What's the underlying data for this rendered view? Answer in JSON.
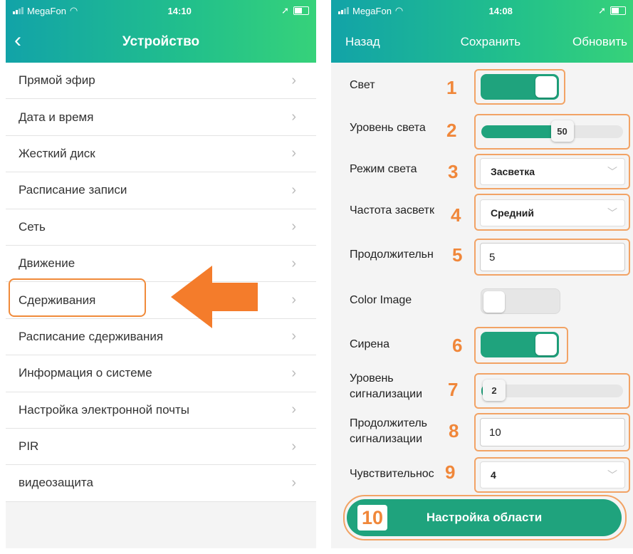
{
  "left": {
    "status": {
      "carrier": "MegaFon",
      "time": "14:10"
    },
    "header": {
      "back": "‹",
      "title": "Устройство"
    },
    "menu": [
      {
        "label": "Прямой эфир"
      },
      {
        "label": "Дата и время"
      },
      {
        "label": "Жесткий диск"
      },
      {
        "label": "Расписание записи"
      },
      {
        "label": "Сеть"
      },
      {
        "label": "Движение"
      },
      {
        "label": "Сдерживания"
      },
      {
        "label": "Расписание сдерживания"
      },
      {
        "label": "Информация о системе"
      },
      {
        "label": "Настройка электронной почты"
      },
      {
        "label": "PIR"
      },
      {
        "label": "видеозащита"
      }
    ],
    "chevron": "›",
    "highlighted_item": "Сдерживания",
    "arrow_color": "#f47c2b"
  },
  "right": {
    "status": {
      "carrier": "MegaFon",
      "time": "14:08"
    },
    "header": {
      "back": "Назад",
      "save": "Сохранить",
      "refresh": "Обновить"
    },
    "light": {
      "label": "Свет",
      "state": true,
      "marker": "1"
    },
    "light_level": {
      "label": "Уровень света",
      "value": "50",
      "fraction": 0.5,
      "marker": "2"
    },
    "light_mode": {
      "label": "Режим света",
      "value": "Засветка",
      "marker": "3"
    },
    "flash_freq": {
      "label": "Частота засветк",
      "value": "Средний",
      "marker": "4"
    },
    "duration": {
      "label": "Продолжительн",
      "value": "5",
      "marker": "5"
    },
    "color_image": {
      "label": "Color Image",
      "state": false
    },
    "siren": {
      "label": "Сирена",
      "state": true,
      "marker": "6"
    },
    "alarm_level": {
      "label_line1": "Уровень",
      "label_line2": "сигнализации",
      "value": "2",
      "fraction": 0.02,
      "marker": "7"
    },
    "alarm_duration": {
      "label_line1": "Продолжитель",
      "label_line2": "сигнализации",
      "value": "10",
      "marker": "8"
    },
    "sensitivity": {
      "label": "Чувствительнос",
      "value": "4",
      "marker": "9"
    },
    "area_button": {
      "label": "Настройка области",
      "marker": "10"
    },
    "chevron_down": "﹀"
  },
  "colors": {
    "accent": "#1fa37d",
    "header_start": "#12a3a8",
    "header_end": "#36d27a",
    "annotation": "#f0873a"
  }
}
